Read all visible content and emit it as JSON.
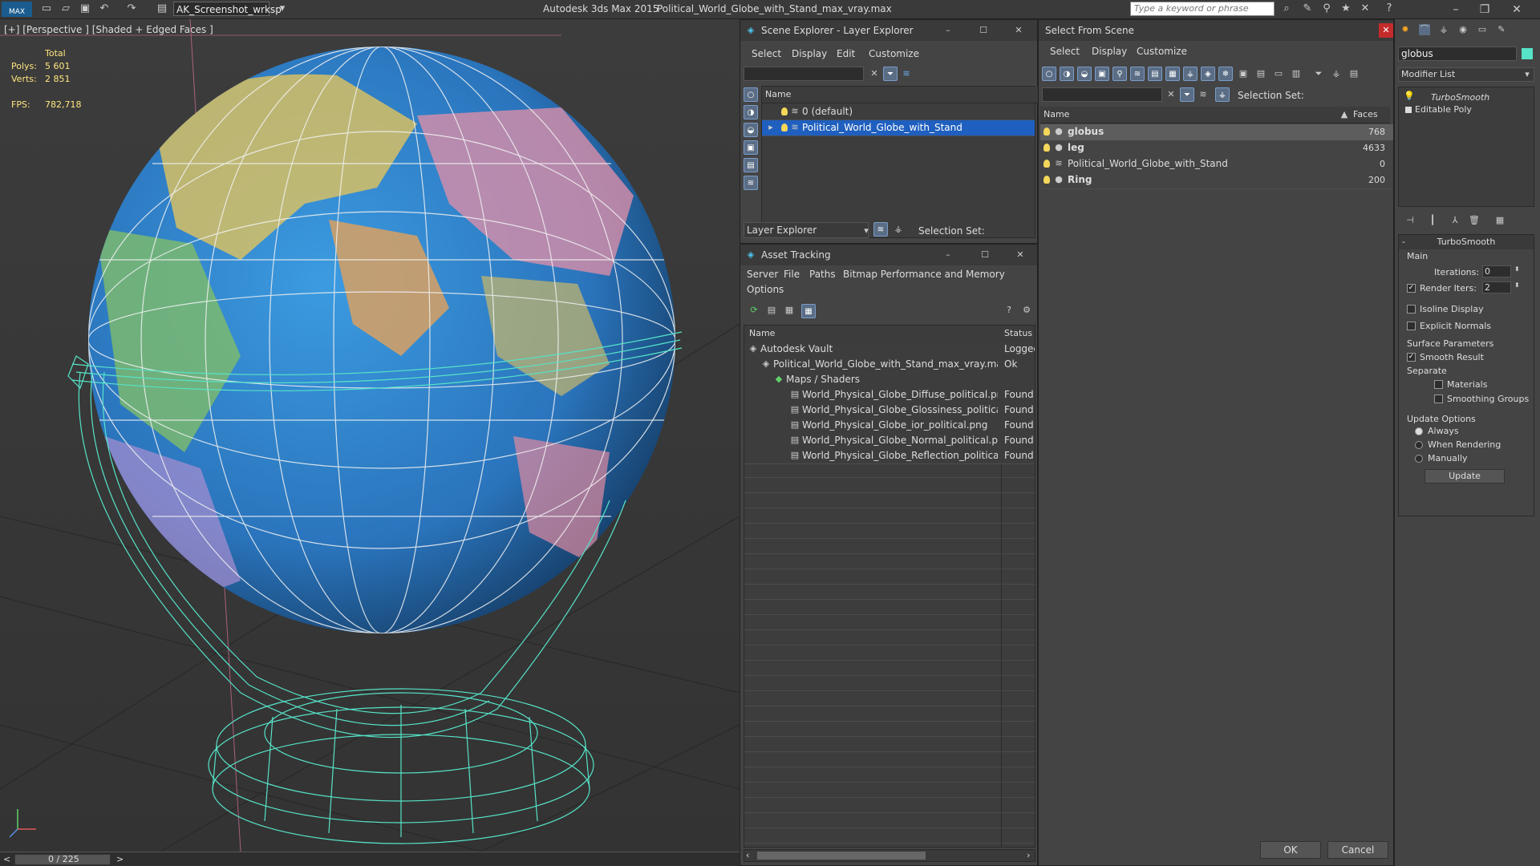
{
  "app": {
    "logo": "MAX",
    "workspace": "AK_Screenshot_wrksp",
    "title": "Autodesk 3ds Max  2015",
    "file": "Political_World_Globe_with_Stand_max_vray.max",
    "search_placeholder": "Type a keyword or phrase"
  },
  "viewport": {
    "label": "[+] [Perspective ] [Shaded + Edged Faces ]",
    "stats": {
      "total_label": "Total",
      "polys_label": "Polys:",
      "polys_value": "5 601",
      "verts_label": "Verts:",
      "verts_value": "2 851",
      "fps_label": "FPS:",
      "fps_value": "782,718"
    },
    "timeline": "0 / 225"
  },
  "scene_explorer": {
    "title": "Scene Explorer - Layer Explorer",
    "menu": [
      "Select",
      "Display",
      "Edit",
      "Customize"
    ],
    "col_name": "Name",
    "items": [
      "0 (default)",
      "Political_World_Globe_with_Stand"
    ],
    "footer_mode": "Layer Explorer",
    "selection_set": "Selection Set:"
  },
  "asset_tracking": {
    "title": "Asset Tracking",
    "menu": [
      "Server",
      "File",
      "Paths",
      "Bitmap Performance and Memory",
      "Options"
    ],
    "col_name": "Name",
    "col_status": "Status",
    "rows": [
      {
        "name": "Autodesk Vault",
        "status": "Logged"
      },
      {
        "name": "Political_World_Globe_with_Stand_max_vray.max",
        "status": "Ok"
      },
      {
        "name": "Maps / Shaders",
        "status": ""
      },
      {
        "name": "World_Physical_Globe_Diffuse_political.png",
        "status": "Found"
      },
      {
        "name": "World_Physical_Globe_Glossiness_political....",
        "status": "Found"
      },
      {
        "name": "World_Physical_Globe_ior_political.png",
        "status": "Found"
      },
      {
        "name": "World_Physical_Globe_Normal_political.p...",
        "status": "Found"
      },
      {
        "name": "World_Physical_Globe_Reflection_political....",
        "status": "Found"
      }
    ]
  },
  "select_from_scene": {
    "title": "Select From Scene",
    "menu": [
      "Select",
      "Display",
      "Customize"
    ],
    "selection_set": "Selection Set:",
    "col_name": "Name",
    "col_faces": "Faces",
    "rows": [
      {
        "name": "globus",
        "faces": "768"
      },
      {
        "name": "leg",
        "faces": "4633"
      },
      {
        "name": "Political_World_Globe_with_Stand",
        "faces": "0"
      },
      {
        "name": "Ring",
        "faces": "200"
      }
    ],
    "ok": "OK",
    "cancel": "Cancel"
  },
  "modify_panel": {
    "object_name": "globus",
    "modifier_list": "Modifier List",
    "stack": [
      "TurboSmooth",
      "Editable Poly"
    ],
    "rollout_title": "TurboSmooth",
    "main_label": "Main",
    "iterations_label": "Iterations:",
    "iterations_value": "0",
    "render_iters_label": "Render Iters:",
    "render_iters_value": "2",
    "isoline": "Isoline Display",
    "explicit_normals": "Explicit Normals",
    "surface_params": "Surface Parameters",
    "smooth_result": "Smooth Result",
    "separate": "Separate",
    "materials": "Materials",
    "smoothing_groups": "Smoothing Groups",
    "update_options": "Update Options",
    "always": "Always",
    "when_rendering": "When Rendering",
    "manually": "Manually",
    "update_btn": "Update"
  },
  "colors": {
    "selection": "#1f5fbf",
    "wire": "#56e3c8",
    "ocean": "#2a7fc9"
  }
}
